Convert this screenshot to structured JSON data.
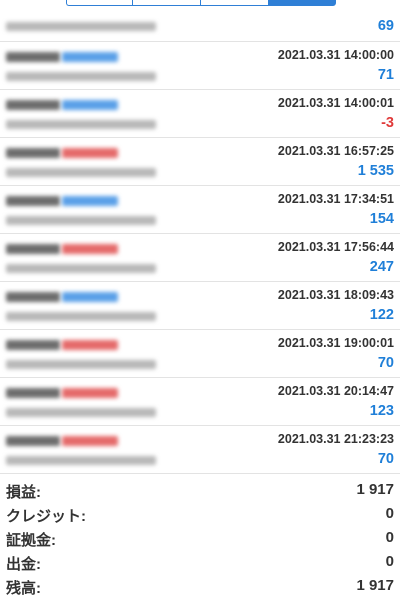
{
  "trades": [
    {
      "time": "",
      "profit": "69",
      "side": "buy"
    },
    {
      "time": "2021.03.31 14:00:00",
      "profit": "71",
      "side": "buy"
    },
    {
      "time": "2021.03.31 14:00:01",
      "profit": "-3",
      "side": "buy"
    },
    {
      "time": "2021.03.31 16:57:25",
      "profit": "1 535",
      "side": "sell"
    },
    {
      "time": "2021.03.31 17:34:51",
      "profit": "154",
      "side": "buy"
    },
    {
      "time": "2021.03.31 17:56:44",
      "profit": "247",
      "side": "sell"
    },
    {
      "time": "2021.03.31 18:09:43",
      "profit": "122",
      "side": "buy"
    },
    {
      "time": "2021.03.31 19:00:01",
      "profit": "70",
      "side": "sell"
    },
    {
      "time": "2021.03.31 20:14:47",
      "profit": "123",
      "side": "sell"
    },
    {
      "time": "2021.03.31 21:23:23",
      "profit": "70",
      "side": "sell"
    }
  ],
  "summary": {
    "profit_label": "損益:",
    "profit_value": "1 917",
    "credit_label": "クレジット:",
    "credit_value": "0",
    "margin_label": "証拠金:",
    "margin_value": "0",
    "withdrawal_label": "出金:",
    "withdrawal_value": "0",
    "balance_label": "残高:",
    "balance_value": "1 917"
  },
  "colors": {
    "accent": "#1f7fd8",
    "negative": "#e03a3a",
    "buy": "#5aa0e8",
    "sell": "#e56a6a"
  }
}
